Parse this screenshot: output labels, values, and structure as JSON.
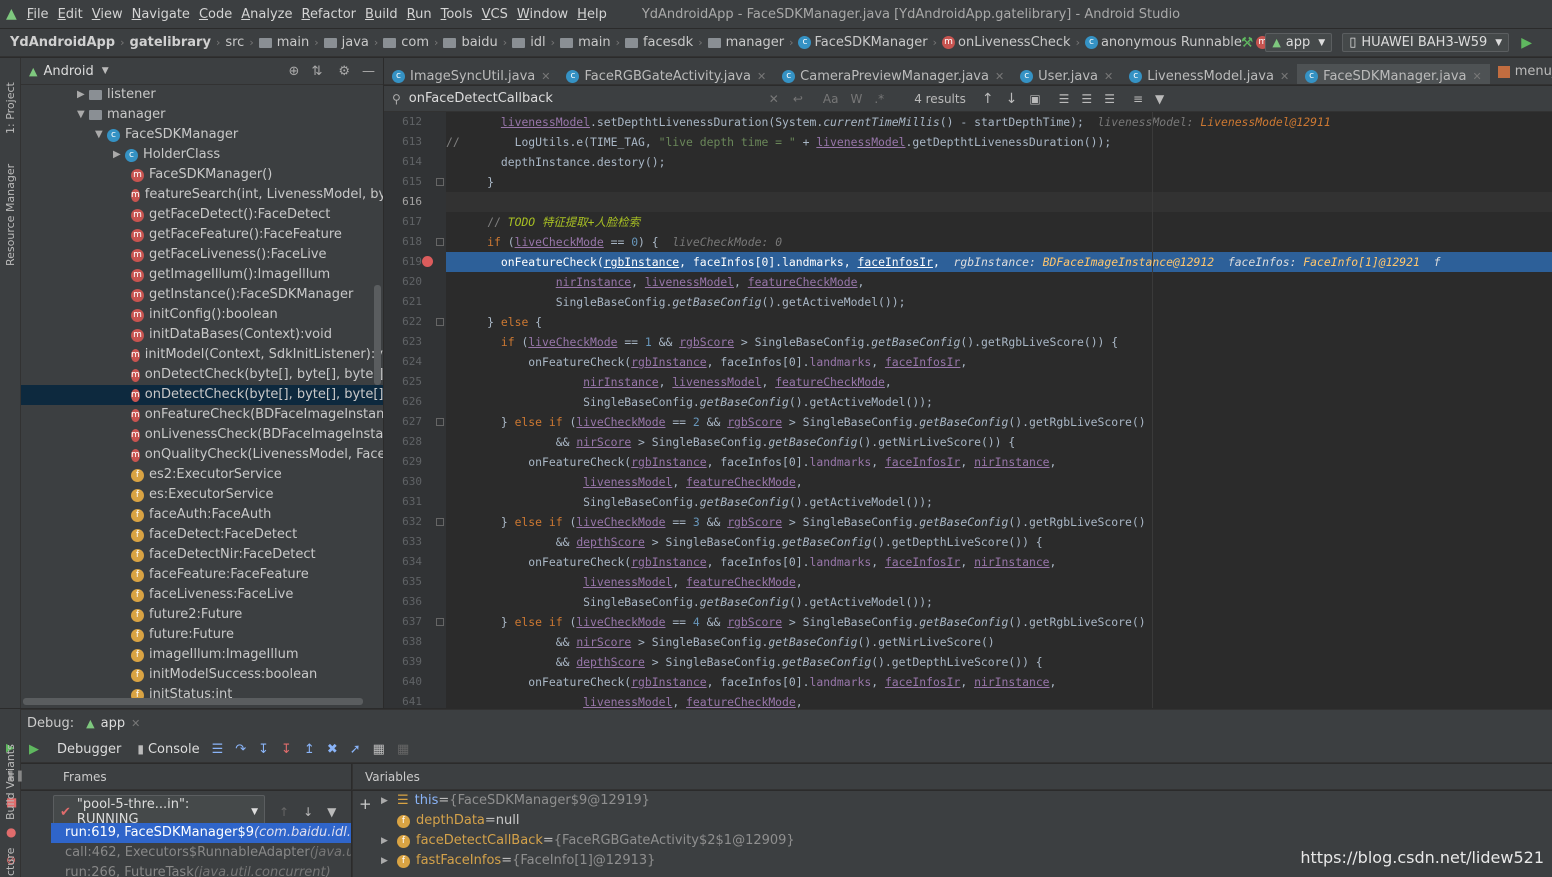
{
  "menu": [
    "File",
    "Edit",
    "View",
    "Navigate",
    "Code",
    "Analyze",
    "Refactor",
    "Build",
    "Run",
    "Tools",
    "VCS",
    "Window",
    "Help"
  ],
  "window_title": "YdAndroidApp - FaceSDKManager.java [YdAndroidApp.gatelibrary] - Android Studio",
  "breadcrumbs": [
    "YdAndroidApp",
    "gatelibrary",
    "src",
    "main",
    "java",
    "com",
    "baidu",
    "idl",
    "main",
    "facesdk",
    "manager",
    "FaceSDKManager",
    "onLivenessCheck",
    "anonymous Runnable",
    "run"
  ],
  "run_config": "app",
  "device": "HUAWEI BAH3-W59",
  "left_strip": [
    "1: Project",
    "Resource Manager"
  ],
  "project_view": "Android",
  "tree": [
    {
      "label": "listener",
      "type": "folder",
      "indent": 0,
      "arrow": "right"
    },
    {
      "label": "manager",
      "type": "folder",
      "indent": 0,
      "arrow": "down"
    },
    {
      "label": "FaceSDKManager",
      "type": "class",
      "indent": 1,
      "arrow": "down"
    },
    {
      "label": "HolderClass",
      "type": "class",
      "indent": 2,
      "arrow": "right"
    },
    {
      "label": "FaceSDKManager()",
      "type": "method",
      "indent": 2
    },
    {
      "label": "featureSearch(int, LivenessModel, byte[],",
      "type": "method",
      "indent": 2
    },
    {
      "label": "getFaceDetect():FaceDetect",
      "type": "method",
      "indent": 2
    },
    {
      "label": "getFaceFeature():FaceFeature",
      "type": "method",
      "indent": 2
    },
    {
      "label": "getFaceLiveness():FaceLive",
      "type": "method",
      "indent": 2
    },
    {
      "label": "getImageIllum():ImageIllum",
      "type": "method",
      "indent": 2
    },
    {
      "label": "getInstance():FaceSDKManager",
      "type": "method",
      "indent": 2
    },
    {
      "label": "initConfig():boolean",
      "type": "method",
      "indent": 2
    },
    {
      "label": "initDataBases(Context):void",
      "type": "method",
      "indent": 2
    },
    {
      "label": "initModel(Context, SdkInitListener):void",
      "type": "method",
      "indent": 2
    },
    {
      "label": "onDetectCheck(byte[], byte[], byte[], int,",
      "type": "method",
      "indent": 2
    },
    {
      "label": "onDetectCheck(byte[], byte[], byte[], int,",
      "type": "method",
      "indent": 2,
      "selected": true
    },
    {
      "label": "onFeatureCheck(BDFaceImageInstance,",
      "type": "method",
      "indent": 2
    },
    {
      "label": "onLivenessCheck(BDFaceImageInstance,",
      "type": "method",
      "indent": 2
    },
    {
      "label": "onQualityCheck(LivenessModel, FaceDet",
      "type": "method",
      "indent": 2
    },
    {
      "label": "es2:ExecutorService",
      "type": "field",
      "indent": 2
    },
    {
      "label": "es:ExecutorService",
      "type": "field",
      "indent": 2
    },
    {
      "label": "faceAuth:FaceAuth",
      "type": "field",
      "indent": 2
    },
    {
      "label": "faceDetect:FaceDetect",
      "type": "field",
      "indent": 2
    },
    {
      "label": "faceDetectNir:FaceDetect",
      "type": "field",
      "indent": 2
    },
    {
      "label": "faceFeature:FaceFeature",
      "type": "field",
      "indent": 2
    },
    {
      "label": "faceLiveness:FaceLive",
      "type": "field",
      "indent": 2
    },
    {
      "label": "future2:Future",
      "type": "field",
      "indent": 2
    },
    {
      "label": "future:Future",
      "type": "field",
      "indent": 2
    },
    {
      "label": "imageIllum:ImageIllum",
      "type": "field",
      "indent": 2
    },
    {
      "label": "initModelSuccess:boolean",
      "type": "field",
      "indent": 2
    },
    {
      "label": "initStatus:int",
      "type": "field",
      "indent": 2
    }
  ],
  "tabs": [
    {
      "label": "ImageSyncUtil.java",
      "icon": "c"
    },
    {
      "label": "FaceRGBGateActivity.java",
      "icon": "c"
    },
    {
      "label": "CameraPreviewManager.java",
      "icon": "c"
    },
    {
      "label": "User.java",
      "icon": "c"
    },
    {
      "label": "LivenessModel.java",
      "icon": "c"
    },
    {
      "label": "FaceSDKManager.java",
      "icon": "c",
      "active": true
    },
    {
      "label": "menu_round_frist.xml",
      "icon": "x"
    }
  ],
  "search": {
    "query": "onFaceDetectCallback",
    "results": "4 results"
  },
  "code_lines": [
    {
      "n": "612",
      "h": "        <span class='u'>livenessModel</span>.setDepthtLivenessDuration(System.<span class='it'>currentTimeMillis</span>() - startDepthTime);  <span class='inl'>livenessModel: </span><span class='inlv'>LivenessModel@12911</span>"
    },
    {
      "n": "613",
      "h": "<span class='cm'>//</span>        LogUtils.e(TIME_TAG, <span class='st'>\"live depth time = \"</span> + <span class='u'>livenessModel</span>.getDepthtLivenessDuration());"
    },
    {
      "n": "614",
      "h": "        depthInstance.destory();"
    },
    {
      "n": "615",
      "h": "      }"
    },
    {
      "n": "616",
      "h": "",
      "cur": true
    },
    {
      "n": "617",
      "h": "      <span class='cm'>// </span><span class='td'>TODO 特征提取+人脸检索</span>"
    },
    {
      "n": "618",
      "h": "      <span class='kw'>if</span> (<span class='u'>liveCheckMode</span> == <span style='color:#6897bb'>0</span>) {  <span class='inl'>liveCheckMode: 0</span>"
    },
    {
      "n": "619",
      "h": "        onFeatureCheck(<span class='u'>rgbInstance</span>, faceInfos[0].<span class='fl'>landmarks</span>, <span class='u'>faceInfosIr</span>,  <span class='inl'>rgbInstance: </span><span class='inlv'>BDFaceImageInstance@12912</span>  <span class='inl'>faceInfos: </span><span class='inlv'>FaceInfo[1]@12921</span>  <span class='inl'>f</span>",
      "hl": true
    },
    {
      "n": "620",
      "h": "                <span class='u'>nirInstance</span>, <span class='u'>livenessModel</span>, <span class='u'>featureCheckMode</span>,"
    },
    {
      "n": "621",
      "h": "                SingleBaseConfig.<span class='it'>getBaseConfig</span>().getActiveModel());"
    },
    {
      "n": "622",
      "h": "      } <span class='kw'>else</span> {"
    },
    {
      "n": "623",
      "h": "        <span class='kw'>if</span> (<span class='u'>liveCheckMode</span> == <span style='color:#6897bb'>1</span> &amp;&amp; <span class='u'>rgbScore</span> &gt; SingleBaseConfig.<span class='it'>getBaseConfig</span>().getRgbLiveScore()) {"
    },
    {
      "n": "624",
      "h": "            onFeatureCheck(<span class='u'>rgbInstance</span>, faceInfos[0].<span class='fl'>landmarks</span>, <span class='u'>faceInfosIr</span>,"
    },
    {
      "n": "625",
      "h": "                    <span class='u'>nirInstance</span>, <span class='u'>livenessModel</span>, <span class='u'>featureCheckMode</span>,"
    },
    {
      "n": "626",
      "h": "                    SingleBaseConfig.<span class='it'>getBaseConfig</span>().getActiveModel());"
    },
    {
      "n": "627",
      "h": "        } <span class='kw'>else if</span> (<span class='u'>liveCheckMode</span> == <span style='color:#6897bb'>2</span> &amp;&amp; <span class='u'>rgbScore</span> &gt; SingleBaseConfig.<span class='it'>getBaseConfig</span>().getRgbLiveScore()"
    },
    {
      "n": "628",
      "h": "                &amp;&amp; <span class='u'>nirScore</span> &gt; SingleBaseConfig.<span class='it'>getBaseConfig</span>().getNirLiveScore()) {"
    },
    {
      "n": "629",
      "h": "            onFeatureCheck(<span class='u'>rgbInstance</span>, faceInfos[0].<span class='fl'>landmarks</span>, <span class='u'>faceInfosIr</span>, <span class='u'>nirInstance</span>,"
    },
    {
      "n": "630",
      "h": "                    <span class='u'>livenessModel</span>, <span class='u'>featureCheckMode</span>,"
    },
    {
      "n": "631",
      "h": "                    SingleBaseConfig.<span class='it'>getBaseConfig</span>().getActiveModel());"
    },
    {
      "n": "632",
      "h": "        } <span class='kw'>else if</span> (<span class='u'>liveCheckMode</span> == <span style='color:#6897bb'>3</span> &amp;&amp; <span class='u'>rgbScore</span> &gt; SingleBaseConfig.<span class='it'>getBaseConfig</span>().getRgbLiveScore()"
    },
    {
      "n": "633",
      "h": "                &amp;&amp; <span class='u'>depthScore</span> &gt; SingleBaseConfig.<span class='it'>getBaseConfig</span>().getDepthLiveScore()) {"
    },
    {
      "n": "634",
      "h": "            onFeatureCheck(<span class='u'>rgbInstance</span>, faceInfos[0].<span class='fl'>landmarks</span>, <span class='u'>faceInfosIr</span>, <span class='u'>nirInstance</span>,"
    },
    {
      "n": "635",
      "h": "                    <span class='u'>livenessModel</span>, <span class='u'>featureCheckMode</span>,"
    },
    {
      "n": "636",
      "h": "                    SingleBaseConfig.<span class='it'>getBaseConfig</span>().getActiveModel());"
    },
    {
      "n": "637",
      "h": "        } <span class='kw'>else if</span> (<span class='u'>liveCheckMode</span> == <span style='color:#6897bb'>4</span> &amp;&amp; <span class='u'>rgbScore</span> &gt; SingleBaseConfig.<span class='it'>getBaseConfig</span>().getRgbLiveScore()"
    },
    {
      "n": "638",
      "h": "                &amp;&amp; <span class='u'>nirScore</span> &gt; SingleBaseConfig.<span class='it'>getBaseConfig</span>().getNirLiveScore()"
    },
    {
      "n": "639",
      "h": "                &amp;&amp; <span class='u'>depthScore</span> &gt; SingleBaseConfig.<span class='it'>getBaseConfig</span>().getDepthLiveScore()) {"
    },
    {
      "n": "640",
      "h": "            onFeatureCheck(<span class='u'>rgbInstance</span>, faceInfos[0].<span class='fl'>landmarks</span>, <span class='u'>faceInfosIr</span>, <span class='u'>nirInstance</span>,"
    },
    {
      "n": "641",
      "h": "                    <span class='u'>livenessModel</span>, <span class='u'>featureCheckMode</span>,"
    }
  ],
  "debug": {
    "label": "Debug:",
    "config": "app",
    "tab_debugger": "Debugger",
    "tab_console": "Console",
    "frames_label": "Frames",
    "variables_label": "Variables",
    "thread": "\"pool-5-thre...in\": RUNNING",
    "frames": [
      {
        "text": "run:619, FaceSDKManager$9 ",
        "pkg": "(com.baidu.idl.main",
        "selected": true
      },
      {
        "text": "call:462, Executors$RunnableAdapter ",
        "pkg": "(java.util.co"
      },
      {
        "text": "run:266, FutureTask ",
        "pkg": "(java.util.concurrent)"
      }
    ],
    "variables": [
      {
        "name": "this",
        "value": "{FaceSDKManager$9@12919}",
        "icon": "list",
        "expand": true,
        "this": true
      },
      {
        "name": "depthData",
        "value": "null",
        "icon": "f",
        "expand": false
      },
      {
        "name": "faceDetectCallBack",
        "value": "{FaceRGBGateActivity$2$1@12909}",
        "icon": "f",
        "expand": true
      },
      {
        "name": "fastFaceInfos",
        "value": "{FaceInfo[1]@12913}",
        "icon": "f",
        "expand": true
      }
    ]
  },
  "bottom_strip": [
    "Build Variants",
    "cture"
  ],
  "watermark": "https://blog.csdn.net/lidew521"
}
